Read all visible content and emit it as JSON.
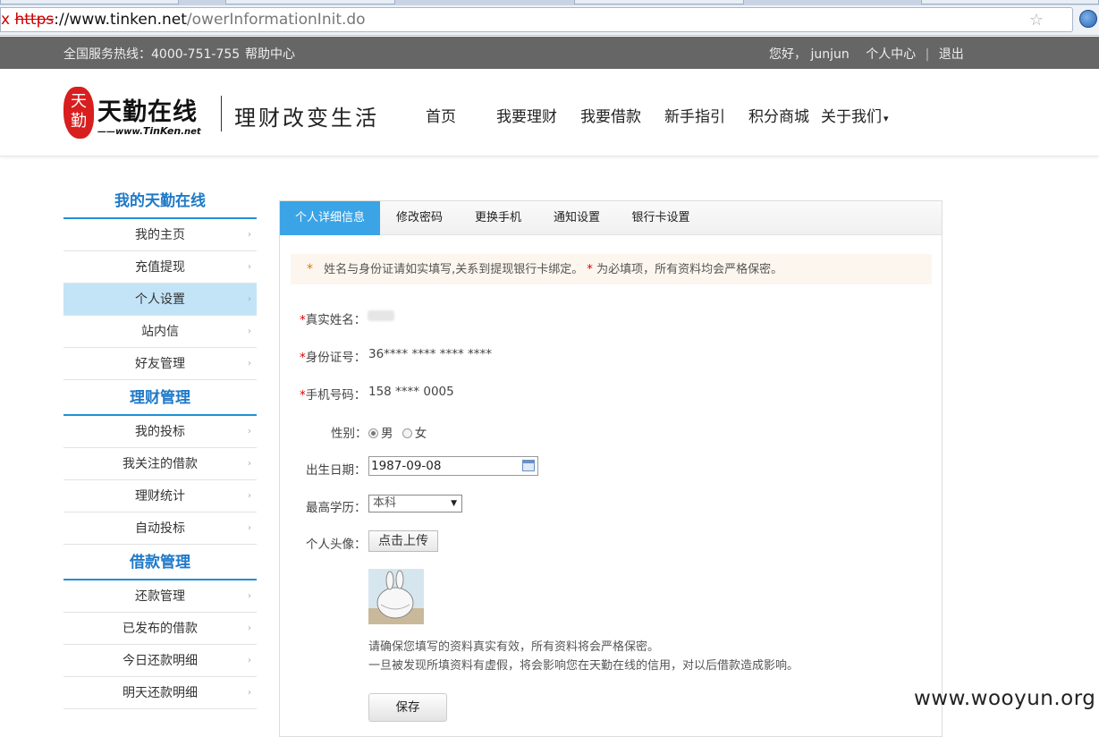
{
  "browser": {
    "url_prefix": "x ",
    "url_protocol": "https",
    "url_sep": "://",
    "url_host": "www.tinken.net",
    "url_path": "/owerInformationInit.do"
  },
  "topbar": {
    "hotline": "全国服务热线：4000-751-755",
    "help": "帮助中心",
    "greeting": "您好， junjun",
    "personal_center": "个人中心",
    "divider": "|",
    "logout": "退出"
  },
  "header": {
    "logo_seal": "天勤",
    "logo_name": "天勤在线",
    "logo_url_prefix": "——www.",
    "logo_url_brand": "TinKen",
    "logo_url_suffix": ".net",
    "slogan": "理财改变生活",
    "nav": [
      {
        "label": "首页"
      },
      {
        "label": "我要理财"
      },
      {
        "label": "我要借款"
      },
      {
        "label": "新手指引"
      },
      {
        "label": "积分商城"
      },
      {
        "label": "关于我们"
      }
    ],
    "nav_more_caret": "▾"
  },
  "sidebar": {
    "arrow_glyph": "›",
    "sections": [
      {
        "title": "我的天勤在线",
        "items": [
          "我的主页",
          "充值提现",
          "个人设置",
          "站内信",
          "好友管理"
        ]
      },
      {
        "title": "理财管理",
        "items": [
          "我的投标",
          "我关注的借款",
          "理财统计",
          "自动投标"
        ]
      },
      {
        "title": "借款管理",
        "items": [
          "还款管理",
          "已发布的借款",
          "今日还款明细",
          "明天还款明细"
        ]
      }
    ],
    "active_item": "个人设置"
  },
  "panel": {
    "tabs": [
      "个人详细信息",
      "修改密码",
      "更换手机",
      "通知设置",
      "银行卡设置"
    ],
    "active_tab": "个人详细信息",
    "notice_star": "*",
    "notice_text1": "姓名与身份证请如实填写,关系到提现银行卡绑定。",
    "notice_text2": "为必填项，所有资料均会严格保密。",
    "required_mark": "*",
    "fields": {
      "real_name_label": "真实姓名：",
      "id_label": "身份证号：",
      "id_value": "36**** **** **** ****",
      "phone_label": "手机号码：",
      "phone_value": "158 **** 0005",
      "gender_label": "性别：",
      "gender_male": "男",
      "gender_female": "女",
      "gender_selected": "男",
      "birth_label": "出生日期：",
      "birth_value": "1987-09-08",
      "edu_label": "最高学历：",
      "edu_value": "本科",
      "avatar_label": "个人头像：",
      "upload_button": "点击上传"
    },
    "help_line1": "请确保您填写的资料真实有效，所有资料将会严格保密。",
    "help_line2": "一旦被发现所填资料有虚假，将会影响您在天勤在线的信用，对以后借款造成影响。",
    "save_button": "保存"
  },
  "watermark": "www.wooyun.org"
}
